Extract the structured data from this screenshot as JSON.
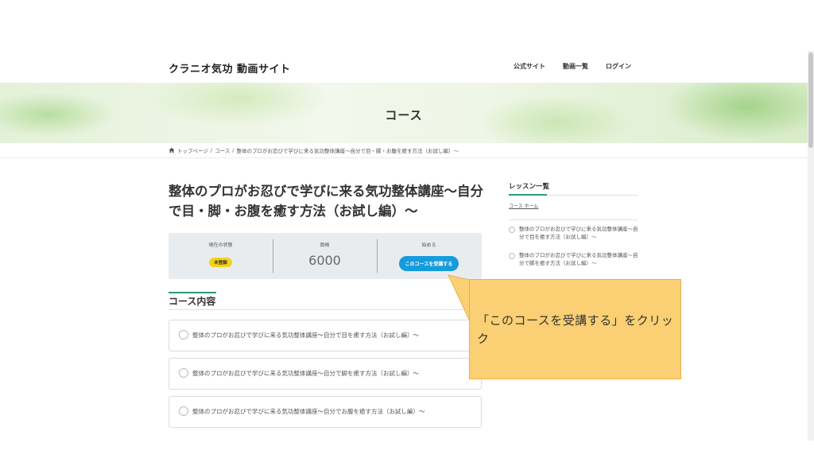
{
  "header": {
    "site_title": "クラニオ気功 動画サイト",
    "nav": [
      "公式サイト",
      "動画一覧",
      "ログイン"
    ]
  },
  "hero": {
    "title": "コース"
  },
  "breadcrumb": {
    "home": "トップページ",
    "sep": "/",
    "parent": "コース",
    "current": "整体のプロがお忍びで学びに来る気功整体講座〜自分で目・脚・お腹を癒す方法（お試し編）〜"
  },
  "course": {
    "title": "整体のプロがお忍びで学びに来る気功整体講座〜自分で目・脚・お腹を癒す方法（お試し編）〜",
    "status_label": "現在の状態",
    "status_badge": "未登録",
    "price_label": "価格",
    "price": "6000",
    "start_label": "始める",
    "enroll_button": "このコースを受講する"
  },
  "content": {
    "heading": "コース内容",
    "lessons": [
      "整体のプロがお忍びで学びに来る気功整体講座〜自分で目を癒す方法（お試し編）〜",
      "整体のプロがお忍びで学びに来る気功整体講座〜自分で脚を癒す方法（お試し編）〜",
      "整体のプロがお忍びで学びに来る気功整体講座〜自分でお腹を癒す方法（お試し編）〜"
    ]
  },
  "sidebar": {
    "heading": "レッスン一覧",
    "home_link": "コース ホーム",
    "items": [
      "整体のプロがお忍びで学びに来る気功整体講座〜自分で目を癒す方法（お試し編）〜",
      "整体のプロがお忍びで学びに来る気功整体講座〜自分で脚を癒す方法（お試し編）〜"
    ]
  },
  "callout": {
    "text": "「このコースを受講する」をクリック"
  },
  "colors": {
    "accent_green": "#2a9d6f",
    "button_blue": "#169cdb",
    "badge_yellow": "#f2d21b",
    "callout_bg": "#fbd074"
  }
}
